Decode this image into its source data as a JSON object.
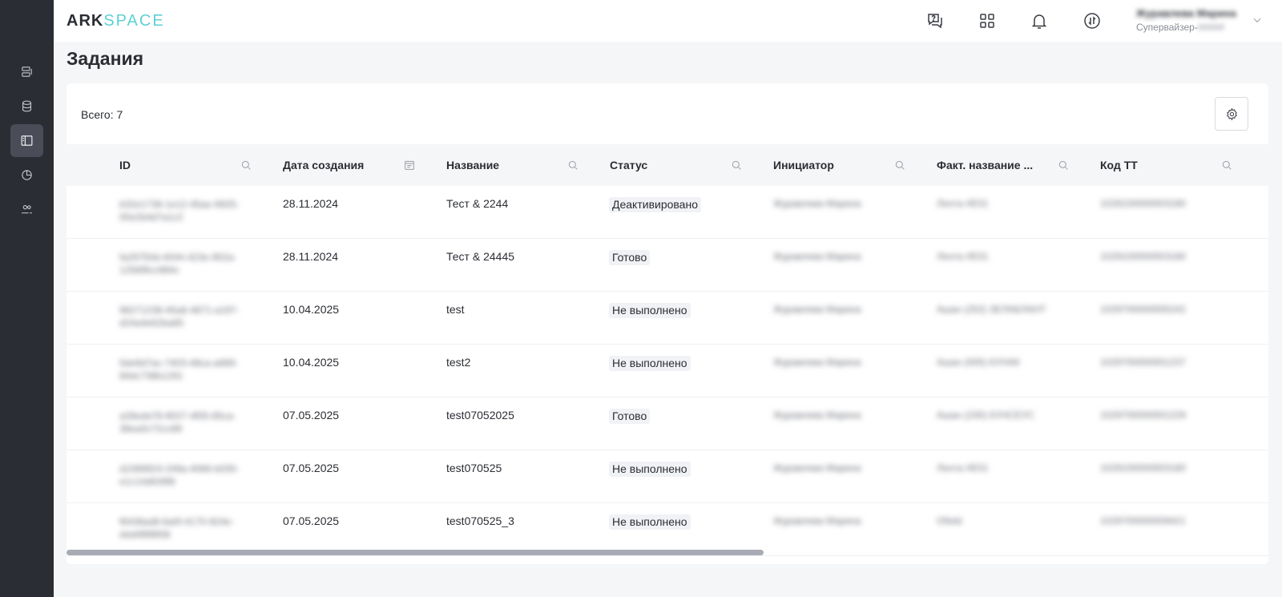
{
  "logo": {
    "part1": "ARK",
    "part2": "SPACE"
  },
  "user": {
    "name": "Журавлева Марина",
    "role_visible": "Супервайзер-",
    "role_hidden": "#####"
  },
  "page": {
    "title": "Задания",
    "total": "Всего: 7"
  },
  "columns": [
    {
      "label": "ID",
      "icon": "search-icon"
    },
    {
      "label": "Дата создания",
      "icon": "calendar-icon"
    },
    {
      "label": "Название",
      "icon": "search-icon"
    },
    {
      "label": "Статус",
      "icon": "search-icon"
    },
    {
      "label": "Инициатор",
      "icon": "search-icon"
    },
    {
      "label": "Факт. название ...",
      "icon": "search-icon"
    },
    {
      "label": "Код ТТ",
      "icon": "search-icon"
    }
  ],
  "rows": [
    {
      "id": "b32e1736-1e12-45ae-9925-00e2b4d7a1c2",
      "date": "28.11.2024",
      "name": "Тест & 2244",
      "status": "Деактивировано",
      "initiator": "Журавлева Марина",
      "fact_name": "Лента #Е01",
      "code": "1029100000003180"
    },
    {
      "id": "fa29750d-4044-423e-902a-1256f9cc984c",
      "date": "28.11.2024",
      "name": "Тест & 24445",
      "status": "Готово",
      "initiator": "Журавлева Марина",
      "fact_name": "Лента #Е01",
      "code": "1029100000003180"
    },
    {
      "id": "98271238-45a8-4871-a197-d24a4e62ba65",
      "date": "10.04.2025",
      "name": "test",
      "status": "Не выполнено",
      "initiator": "Журавлева Марина",
      "fact_name": "Ашан (252) ЗЕЛАБЛАНТ",
      "code": "1029700000005242"
    },
    {
      "id": "5de9d7ac-7403-48ca-a689-84dc738b1291",
      "date": "10.04.2025",
      "name": "test2",
      "status": "Не выполнено",
      "initiator": "Журавлева Марина",
      "fact_name": "Ашан (005) КУНАК",
      "code": "1029700000001237"
    },
    {
      "id": "a28eda78-9027-4f05-85ca-38ea0c72cc89",
      "date": "07.05.2025",
      "name": "test07052025",
      "status": "Готово",
      "initiator": "Журавлева Марина",
      "fact_name": "Ашан (230) КУНСЕУС",
      "code": "1029700000001229"
    },
    {
      "id": "d1089924-249a-4066-b030-e1c14d639f8",
      "date": "07.05.2025",
      "name": "test070525",
      "status": "Не выполнено",
      "initiator": "Журавлева Марина",
      "fact_name": "Лента #Е01",
      "code": "1029100000003180"
    },
    {
      "id": "f6438ad8-6a0f-4170-924e-ebd4f8f8f08",
      "date": "07.05.2025",
      "name": "test070525_3",
      "status": "Не выполнено",
      "initiator": "Журавлева Марина",
      "fact_name": "Ofield",
      "code": "1029700000009421"
    }
  ],
  "scroll": {
    "horizontal_fraction": 0.58
  }
}
